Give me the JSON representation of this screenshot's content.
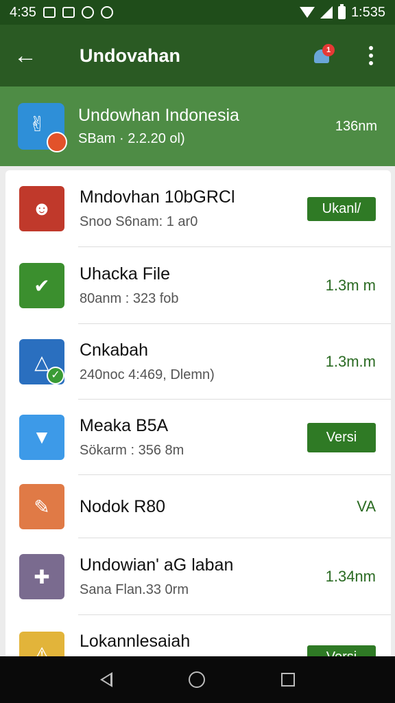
{
  "status_bar": {
    "time": "4:35",
    "clock_right": "1:535"
  },
  "app_bar": {
    "back_icon": "arrow-left-icon",
    "title": "Undovahan",
    "notification_badge": "1"
  },
  "header": {
    "title": "Undowhan Indonesia",
    "subtitle": "SBam · 2.2.20 ol)",
    "size": "136nm"
  },
  "rows": [
    {
      "title": "Mndovhan 10bGRCl",
      "subtitle": "Snoo S6nam: 1 ar0",
      "action": "Ukanl/",
      "icon_color": "#c0392b"
    },
    {
      "title": "Uhacka File",
      "subtitle": "80anm : 323 fob",
      "size": "1.3m m",
      "icon_color": "#3b8f2e"
    },
    {
      "title": "Cnkabah",
      "subtitle": "240noc 4:469, Dlemn)",
      "size": "1.3m.m",
      "icon_color": "#2a6fbf"
    },
    {
      "title": "Meaka B5A",
      "subtitle": "Sökarm : 356 8m",
      "action": "Versi",
      "icon_color": "#3d9ae8"
    },
    {
      "title": "Nodok R80",
      "subtitle": "",
      "size": "VA",
      "icon_color": "#e07a46"
    },
    {
      "title": "Undowian' aG laban",
      "subtitle": "Sana Flan.33 0rm",
      "size": "1.34nm",
      "icon_color": "#7a6b8f"
    },
    {
      "title": "Lokannlesaiah",
      "subtitle": "",
      "action": "Versi",
      "icon_color": "#e2b43a"
    }
  ]
}
